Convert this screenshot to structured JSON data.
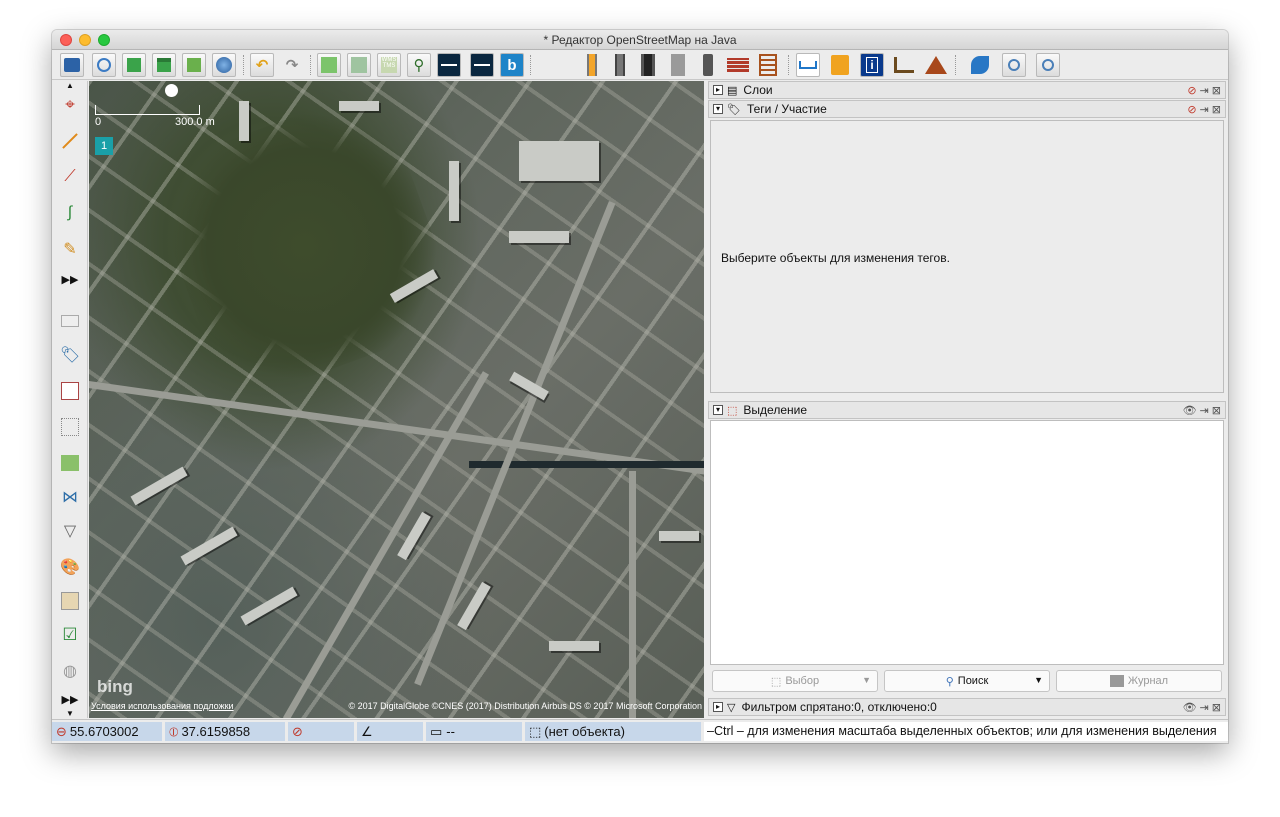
{
  "window": {
    "title": "* Редактор OpenStreetMap на Java"
  },
  "map": {
    "scale_zero": "0",
    "scale_label": "300.0 m",
    "layer_badge": "1",
    "provider_logo": "bing",
    "attribution_left": "Условия использования подложки",
    "attribution_right": "© 2017 DigitalGlobe ©CNES (2017) Distribution Airbus DS © 2017 Microsoft Corporation"
  },
  "panels": {
    "layers": {
      "title": "Слои"
    },
    "tags": {
      "title": "Теги / Участие",
      "empty_message": "Выберите объекты для изменения тегов."
    },
    "selection": {
      "title": "Выделение",
      "buttons": {
        "select": "Выбор",
        "search": "Поиск",
        "history": "Журнал"
      }
    },
    "filter": {
      "title": "Фильтром спрятано:0, отключено:0"
    }
  },
  "statusbar": {
    "lat": "55.6703002",
    "lon": "37.6159858",
    "length": "--",
    "object": "(нет объекта)",
    "help": "–Ctrl – для изменения масштаба выделенных объектов; или для изменения выделения"
  },
  "colors": {
    "status_field": "#c7d7ea",
    "badge": "#1aa0a8"
  }
}
